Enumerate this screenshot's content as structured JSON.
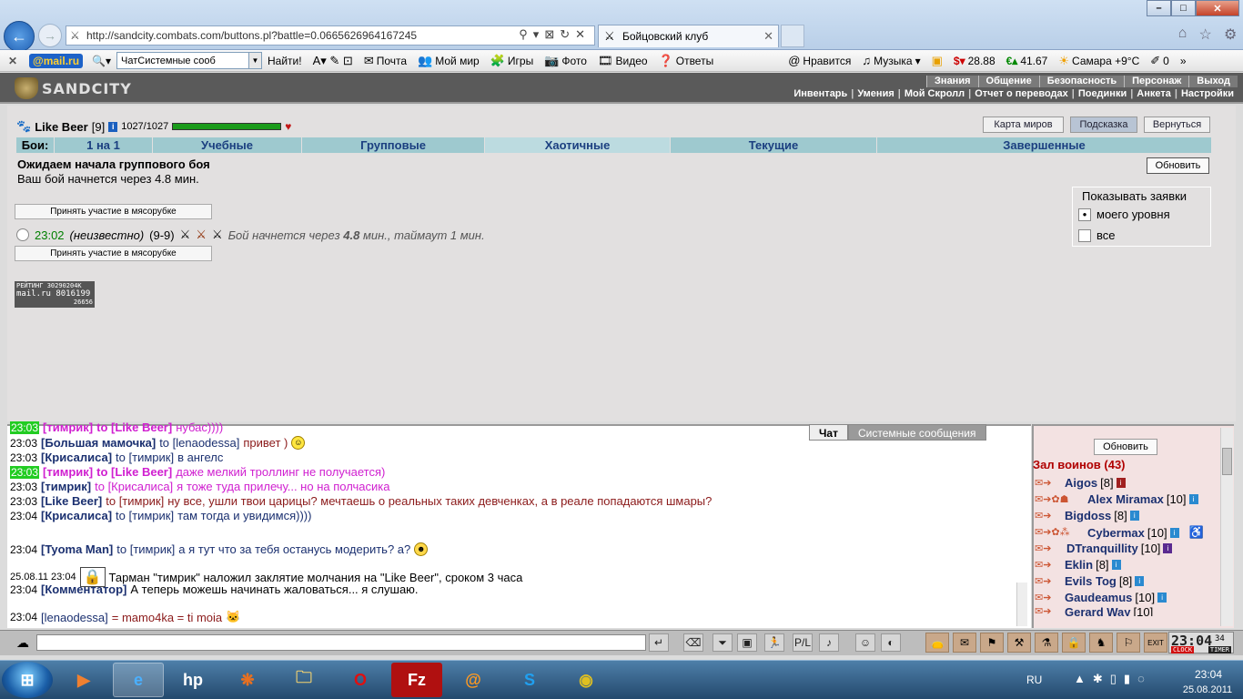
{
  "browser": {
    "url": "http://sandcity.combats.com/buttons.pl?battle=0.0665626964167245",
    "tab_title": "Бойцовский клуб",
    "window_buttons": {
      "min": "–",
      "max": "□",
      "close": "✕"
    }
  },
  "mailbar": {
    "logo": "@mail.ru",
    "search_value": "ЧатСистемные сооб",
    "find": "Найти!",
    "items": [
      "Почта",
      "Мой мир",
      "Игры",
      "Фото",
      "Видео",
      "Ответы",
      "Нравится",
      "Музыка"
    ],
    "rates": {
      "usd": "28.88",
      "eur": "41.67"
    },
    "weather": "Самара +9°C",
    "counter": "0"
  },
  "game": {
    "logo": "SANDCITY",
    "menu_top": [
      "Знания",
      "Общение",
      "Безопасность",
      "Персонаж",
      "Выход"
    ],
    "menu_sub": [
      "Инвентарь",
      "Умения",
      "Мой Скролл",
      "Отчет о переводах",
      "Поединки",
      "Анкета",
      "Настройки"
    ],
    "player": {
      "name": "Like Beer",
      "level": "[9]",
      "hp": "1027/1027",
      "hp_fraction": 1.0
    },
    "buttons": {
      "map": "Карта миров",
      "hint": "Подсказка",
      "back": "Вернуться",
      "refresh": "Обновить"
    },
    "tabs_label": "Бои:",
    "tabs": [
      "1 на 1",
      "Учебные",
      "Групповые",
      "Хаотичные",
      "Текущие",
      "Завершенные"
    ],
    "active_tab": "Хаотичные",
    "wait_title": "Ожидаем начала группового боя",
    "wait_sub": "Ваш бой начнется через 4.8 мин.",
    "join_label": "Принять участие в мясорубке",
    "battle": {
      "time": "23:02",
      "who": "(неизвестно)",
      "range": "(9-9)",
      "note_prefix": "Бой начнется через",
      "minutes": "4.8",
      "note_suffix": "мин., таймаут 1 мин."
    },
    "show": {
      "title": "Показывать заявки",
      "opt1": "моего уровня",
      "opt2": "все",
      "selected": "моего уровня"
    },
    "rating": {
      "l1": "РЕЙТИНГ 30290204К",
      "l2": "mail.ru 8016199",
      "l3": "26656"
    }
  },
  "chat": {
    "tabs": [
      "Чат",
      "Системные сообщения"
    ],
    "messages": [
      {
        "time": "23:03",
        "nick": "[тимрик]",
        "to": "to [Like Beer]",
        "text": "нубас))))"
      },
      {
        "time": "23:03",
        "nick": "[Большая мамочка]",
        "to": "to [lenaodessa]",
        "text": "привет )"
      },
      {
        "time": "23:03",
        "nick": "[Крисалиса]",
        "to": "to [тимрик]",
        "text": "в ангелс"
      },
      {
        "time": "23:03",
        "nick": "[тимрик]",
        "to": "to [Like Beer]",
        "text": "даже мелкий троллинг не получается)"
      },
      {
        "time": "23:03",
        "nick": "[тимрик]",
        "to": "to [Крисалиса]",
        "text": "я тоже туда прилечу... но на полчасика"
      },
      {
        "time": "23:03",
        "nick": "[Like Beer]",
        "to": "to [тимрик]",
        "text": "ну все, ушли твои царицы? мечтаешь о реальных таких девченках, а в реале попадаются шмары?"
      },
      {
        "time": "23:04",
        "nick": "[Крисалиса]",
        "to": "to [тимрик]",
        "text": "там тогда и увидимся))))"
      },
      {
        "time": "23:04",
        "nick": "[Tyoma Man]",
        "to": "to [тимрик]",
        "text": "а я тут что за тебя останусь модерить? а?"
      },
      {
        "time": "25.08.11 23:04",
        "nick": "",
        "to": "",
        "text": "Тарман \"тимрик\" наложил заклятие молчания на \"Like Beer\", сроком 3 часа"
      },
      {
        "time": "23:04",
        "nick": "[Комментатор]",
        "to": "",
        "text": "А теперь можешь начинать жаловаться... я слушаю."
      },
      {
        "time": "23:04",
        "nick": "[lenaodessa]",
        "to": "",
        "text": "= mamo4ka = ti moia"
      }
    ]
  },
  "room": {
    "refresh": "Обновить",
    "title": "Зал воинов (43)",
    "warriors": [
      {
        "name": "Aigos",
        "lvl": "[8]"
      },
      {
        "name": "Alex Miramax",
        "lvl": "[10]"
      },
      {
        "name": "Bigdoss",
        "lvl": "[8]"
      },
      {
        "name": "Cybermax",
        "lvl": "[10]"
      },
      {
        "name": "DTranquillity",
        "lvl": "[10]"
      },
      {
        "name": "Eklin",
        "lvl": "[8]"
      },
      {
        "name": "Evils Tog",
        "lvl": "[8]"
      },
      {
        "name": "Gaudeamus",
        "lvl": "[10]"
      },
      {
        "name": "Gerard Way",
        "lvl": "[10]"
      }
    ]
  },
  "clock": {
    "time": "23:04",
    "sec": "34",
    "clock_label": "CLOCK",
    "timer_label": "TIMER",
    "exit": "EXIT"
  },
  "taskbar": {
    "lang": "RU",
    "time": "23:04",
    "date": "25.08.2011"
  },
  "colors": {
    "accent": "#9ec9cf",
    "active_tab": "#bcdbe0",
    "hp": "#1a9b1a",
    "room_title": "#b00000"
  }
}
